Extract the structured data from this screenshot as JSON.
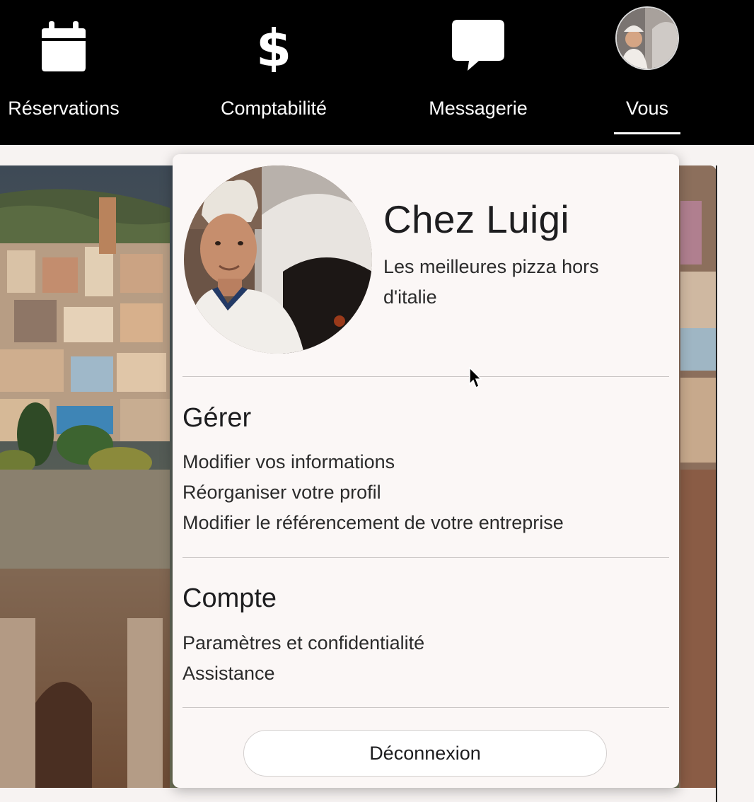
{
  "nav": {
    "items": [
      {
        "label": "Réservations",
        "icon": "calendar-icon"
      },
      {
        "label": "Comptabilité",
        "icon": "dollar-icon"
      },
      {
        "label": "Messagerie",
        "icon": "chat-bubble-icon"
      },
      {
        "label": "Vous",
        "icon": "avatar",
        "active": true
      }
    ]
  },
  "profile": {
    "name": "Chez Luigi",
    "tagline": "Les meilleures pizza hors d'italie"
  },
  "manage": {
    "title": "Gérer",
    "links": [
      "Modifier vos informations",
      "Réorganiser votre profil",
      "Modifier le référencement de votre entreprise"
    ]
  },
  "account": {
    "title": "Compte",
    "links": [
      "Paramètres et confidentialité",
      "Assistance"
    ]
  },
  "logout": {
    "label": "Déconnexion"
  },
  "colors": {
    "topbar": "#000000",
    "dropdown_bg": "#fbf7f6",
    "text": "#1d1d1f"
  }
}
